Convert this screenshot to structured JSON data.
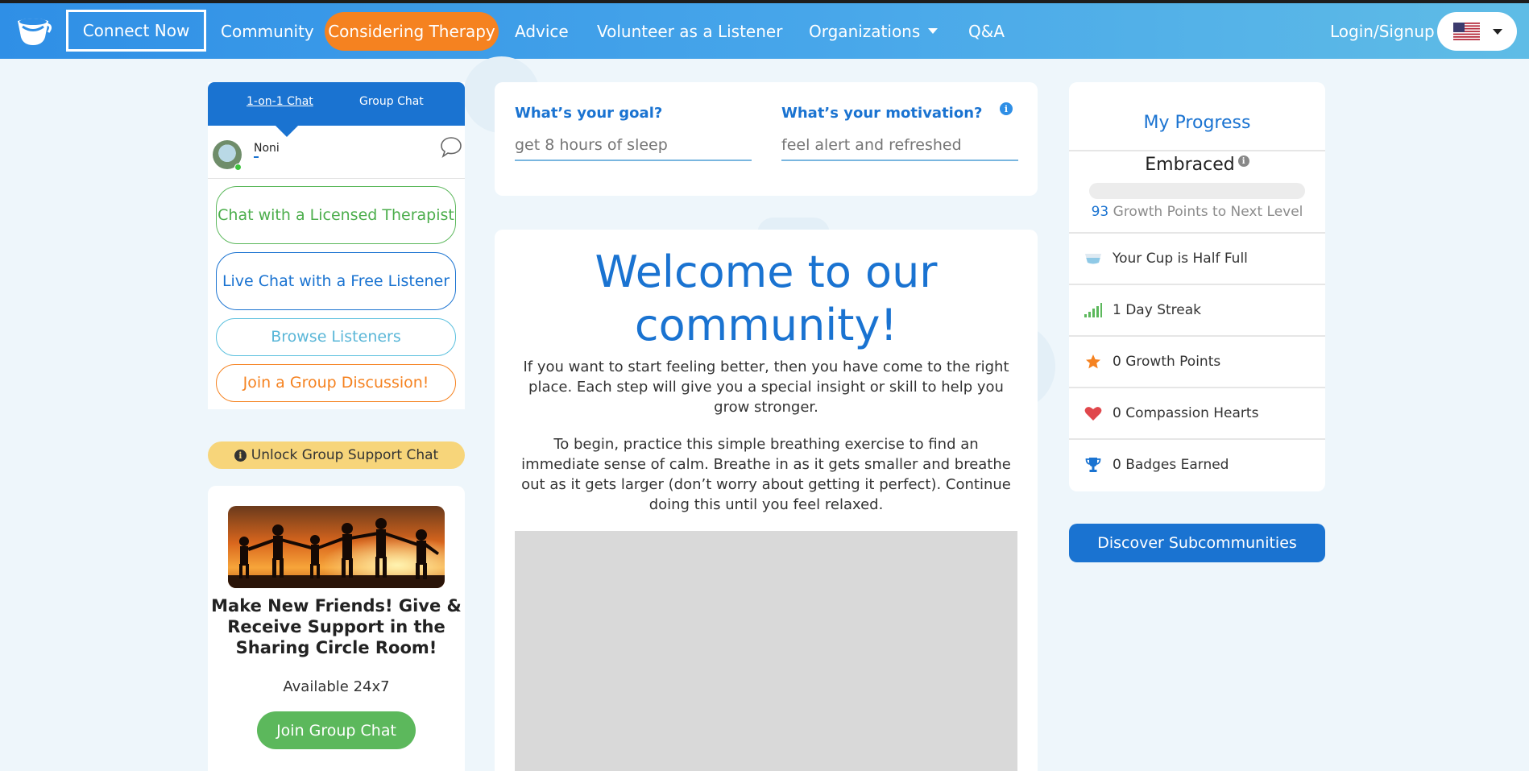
{
  "nav": {
    "items": [
      {
        "label": "Connect Now"
      },
      {
        "label": "Community"
      },
      {
        "label": "Considering Therapy"
      },
      {
        "label": "Advice"
      },
      {
        "label": "Volunteer as a Listener"
      },
      {
        "label": "Organizations"
      },
      {
        "label": "Q&A"
      }
    ],
    "login_label": "Login/Signup",
    "language_flag": "us-flag-icon",
    "colors": {
      "accent": "#1a73d1",
      "therapy": "#f58220"
    }
  },
  "chat_panel": {
    "tabs": [
      {
        "label": "1-on-1 Chat",
        "active": true
      },
      {
        "label": "Group Chat",
        "active": false
      }
    ],
    "listener_name": "Noni",
    "buttons": {
      "therapist": "Chat with a Licensed Therapist",
      "free_listener": "Live Chat with a Free Listener",
      "browse": "Browse Listeners",
      "group": "Join a Group Discussion!"
    }
  },
  "unlock": {
    "label": "Unlock Group Support Chat"
  },
  "group_card": {
    "title": "Make New Friends! Give & Receive Support in the Sharing Circle Room!",
    "availability": "Available 24x7",
    "button": "Join Group Chat"
  },
  "goal": {
    "goal_label": "What’s your goal?",
    "goal_placeholder": "get 8 hours of sleep",
    "motivation_label": "What’s your motivation?",
    "motivation_placeholder": "feel alert and refreshed"
  },
  "welcome": {
    "title": "Welcome to our community!",
    "paragraph1": "If you want to start feeling better, then you have come to the right place. Each step will give you a special insight or skill to help you grow stronger.",
    "paragraph2": "To begin, practice this simple breathing exercise to find an immediate sense of calm. Breathe in as it gets smaller and breathe out as it gets larger (don’t worry about getting it perfect). Continue doing this until you feel relaxed."
  },
  "progress": {
    "title": "My Progress",
    "level": "Embraced",
    "bar_fraction": 0,
    "points_to_next": "93",
    "points_to_next_label": "Growth Points to Next Level",
    "stats": [
      {
        "icon": "cup-icon",
        "text": "Your Cup is Half Full"
      },
      {
        "icon": "signal-bars-icon",
        "text": "1 Day Streak"
      },
      {
        "icon": "star-icon",
        "text": "0 Growth Points"
      },
      {
        "icon": "heart-icon",
        "text": "0 Compassion Hearts"
      },
      {
        "icon": "trophy-icon",
        "text": "0 Badges Earned"
      }
    ]
  },
  "discover": {
    "label": "Discover Subcommunities"
  }
}
